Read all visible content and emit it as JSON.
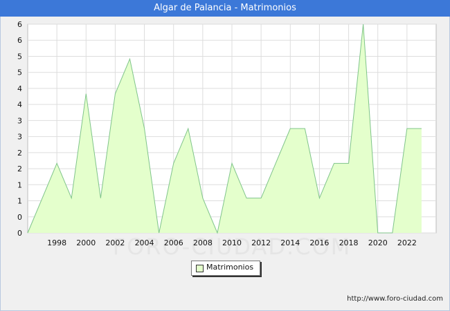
{
  "title": "Algar de Palancia - Matrimonios",
  "footer_url": "http://www.foro-ciudad.com",
  "watermark": "FORO-CIUDAD.COM",
  "colors": {
    "header_bg": "#3c78d8",
    "area_fill": "#e4ffcc",
    "area_line": "#7fc48a",
    "grid": "#dddddd",
    "plot_bg": "#ffffff"
  },
  "chart_data": {
    "type": "area",
    "title": "Algar de Palancia - Matrimonios",
    "xlabel": "",
    "ylabel": "",
    "x": [
      1996,
      1997,
      1998,
      1999,
      2000,
      2001,
      2002,
      2003,
      2004,
      2005,
      2006,
      2007,
      2008,
      2009,
      2010,
      2011,
      2012,
      2013,
      2014,
      2015,
      2016,
      2017,
      2018,
      2019,
      2020,
      2021,
      2022,
      2023
    ],
    "series": [
      {
        "name": "Matrimonios",
        "values": [
          0,
          1,
          2,
          1,
          4,
          1,
          4,
          5,
          3,
          0,
          2,
          3,
          1,
          0,
          2,
          1,
          1,
          2,
          3,
          3,
          1,
          2,
          2,
          6,
          0,
          0,
          3,
          3
        ]
      }
    ],
    "xlim": [
      1996,
      2024
    ],
    "ylim": [
      0,
      6
    ],
    "x_ticks": [
      "1998",
      "2000",
      "2002",
      "2004",
      "2006",
      "2008",
      "2010",
      "2012",
      "2014",
      "2016",
      "2018",
      "2020",
      "2022"
    ],
    "y_tick_labels": [
      "0",
      "0",
      "1",
      "1",
      "2",
      "2",
      "3",
      "3",
      "4",
      "4",
      "5",
      "5",
      "6",
      "6"
    ],
    "grid": true,
    "legend": "bottom-center"
  }
}
